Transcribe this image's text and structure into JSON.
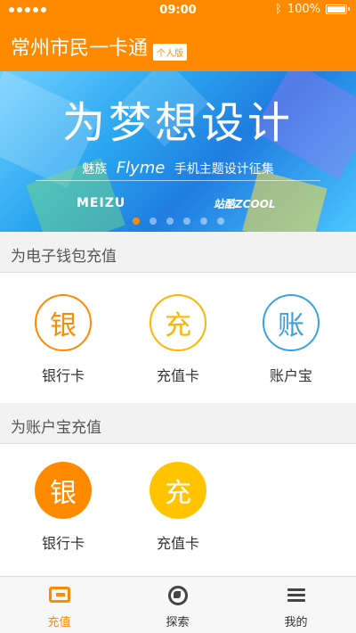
{
  "status_bar": {
    "time": "09:00",
    "battery": "100%",
    "battery_level": 1.0,
    "icons": [
      "signal-dots-icon",
      "bluetooth-icon",
      "battery-icon"
    ]
  },
  "header": {
    "title": "常州市民一卡通",
    "badge": "个人版"
  },
  "banner": {
    "title": "为梦想设计",
    "subtitle_prefix": "魅族",
    "subtitle_brand": "Flyme",
    "subtitle_suffix": "手机主题设计征集",
    "logo_left": "MEIZU",
    "logo_right": "站酷ZCOOL",
    "slide_count": 6,
    "active_slide": 1
  },
  "wallet_section": {
    "title": "为电子钱包充值",
    "items": [
      {
        "glyph": "银",
        "label": "银行卡",
        "icon": "bank-card-icon"
      },
      {
        "glyph": "充",
        "label": "充值卡",
        "icon": "recharge-card-icon"
      },
      {
        "glyph": "账",
        "label": "账户宝",
        "icon": "account-treasure-icon"
      }
    ]
  },
  "account_section": {
    "title": "为账户宝充值",
    "items": [
      {
        "glyph": "银",
        "label": "银行卡",
        "icon": "bank-card-icon"
      },
      {
        "glyph": "充",
        "label": "充值卡",
        "icon": "recharge-card-icon"
      }
    ]
  },
  "tabbar": {
    "tabs": [
      {
        "label": "充值",
        "icon": "card-icon",
        "active": true
      },
      {
        "label": "探索",
        "icon": "globe-icon",
        "active": false
      },
      {
        "label": "我的",
        "icon": "menu-icon",
        "active": false
      }
    ]
  },
  "colors": {
    "brand_orange": "#ff8a00",
    "yellow": "#ffc400",
    "blue": "#3aa0e0"
  }
}
